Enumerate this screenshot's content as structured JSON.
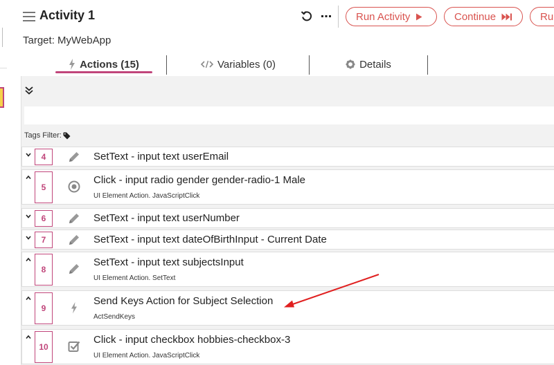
{
  "header": {
    "title": "Activity 1",
    "run_activity_label": "Run Activity",
    "continue_label": "Continue",
    "run_partial_label": "Run"
  },
  "target": {
    "text": "Target: MyWebApp"
  },
  "tabs": [
    {
      "label": "Actions (15)",
      "active": true
    },
    {
      "label": "Variables (0)",
      "active": false
    },
    {
      "label": "Details",
      "active": false
    }
  ],
  "filter": {
    "search_value": "",
    "tags_label": "Tags Filter:"
  },
  "actions": [
    {
      "num": "4",
      "icon": "pencil-icon",
      "chevron": "collapsed",
      "title": "SetText - input text userEmail",
      "subtitle": ""
    },
    {
      "num": "5",
      "icon": "radio-icon",
      "chevron": "expanded",
      "title": "Click - input radio gender gender-radio-1 Male",
      "subtitle": "UI Element Action. JavaScriptClick"
    },
    {
      "num": "6",
      "icon": "pencil-icon",
      "chevron": "collapsed",
      "title": "SetText - input text userNumber",
      "subtitle": ""
    },
    {
      "num": "7",
      "icon": "pencil-icon",
      "chevron": "collapsed",
      "title": "SetText - input text dateOfBirthInput - Current Date",
      "subtitle": ""
    },
    {
      "num": "8",
      "icon": "pencil-icon",
      "chevron": "expanded",
      "title": "SetText - input text subjectsInput",
      "subtitle": "UI Element Action. SetText"
    },
    {
      "num": "9",
      "icon": "lightning-icon",
      "chevron": "expanded",
      "title": "Send Keys Action for Subject Selection",
      "subtitle": "ActSendKeys"
    },
    {
      "num": "10",
      "icon": "checkbox-icon",
      "chevron": "expanded",
      "title": "Click - input checkbox hobbies-checkbox-3",
      "subtitle": "UI Element Action. JavaScriptClick"
    }
  ],
  "colors": {
    "accent": "#c0457a",
    "run_button": "#d9534f",
    "annotation_arrow": "#e02020"
  }
}
